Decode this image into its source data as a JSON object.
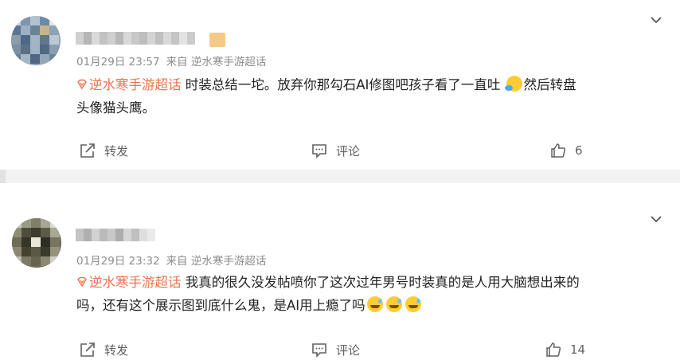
{
  "posts": [
    {
      "time": "01月29日 23:57",
      "source": "来自 逆水寒手游超话",
      "topic": "逆水寒手游超话",
      "text_line1": " 时装总结一坨。放弃你那勾石AI修图吧孩子看了一直吐",
      "text_line1_after": "然后转盘",
      "text_line2": "头像猫头鹰。",
      "emoji": [
        "crying-laughing-emoji"
      ],
      "actions": {
        "repost": "转发",
        "comment": "评论",
        "like_count": "6"
      }
    },
    {
      "time": "01月29日 23:32",
      "source": "来自 逆水寒手游超话",
      "topic": "逆水寒手游超话",
      "text_line1": " 我真的很久没发帖喷你了这次过年男号时装真的是人用大脑想出来的",
      "text_line2": "吗，还有这个展示图到底什么鬼，是AI用上瘾了吗",
      "emoji": [
        "grin-sweat-emoji",
        "grin-sweat-emoji",
        "grin-sweat-emoji"
      ],
      "actions": {
        "repost": "转发",
        "comment": "评论",
        "like_count": "14"
      }
    }
  ],
  "colors": {
    "topic": "#eb7350",
    "meta": "#8c8c8c",
    "action": "#616161",
    "separator": "#f2f2f2"
  }
}
